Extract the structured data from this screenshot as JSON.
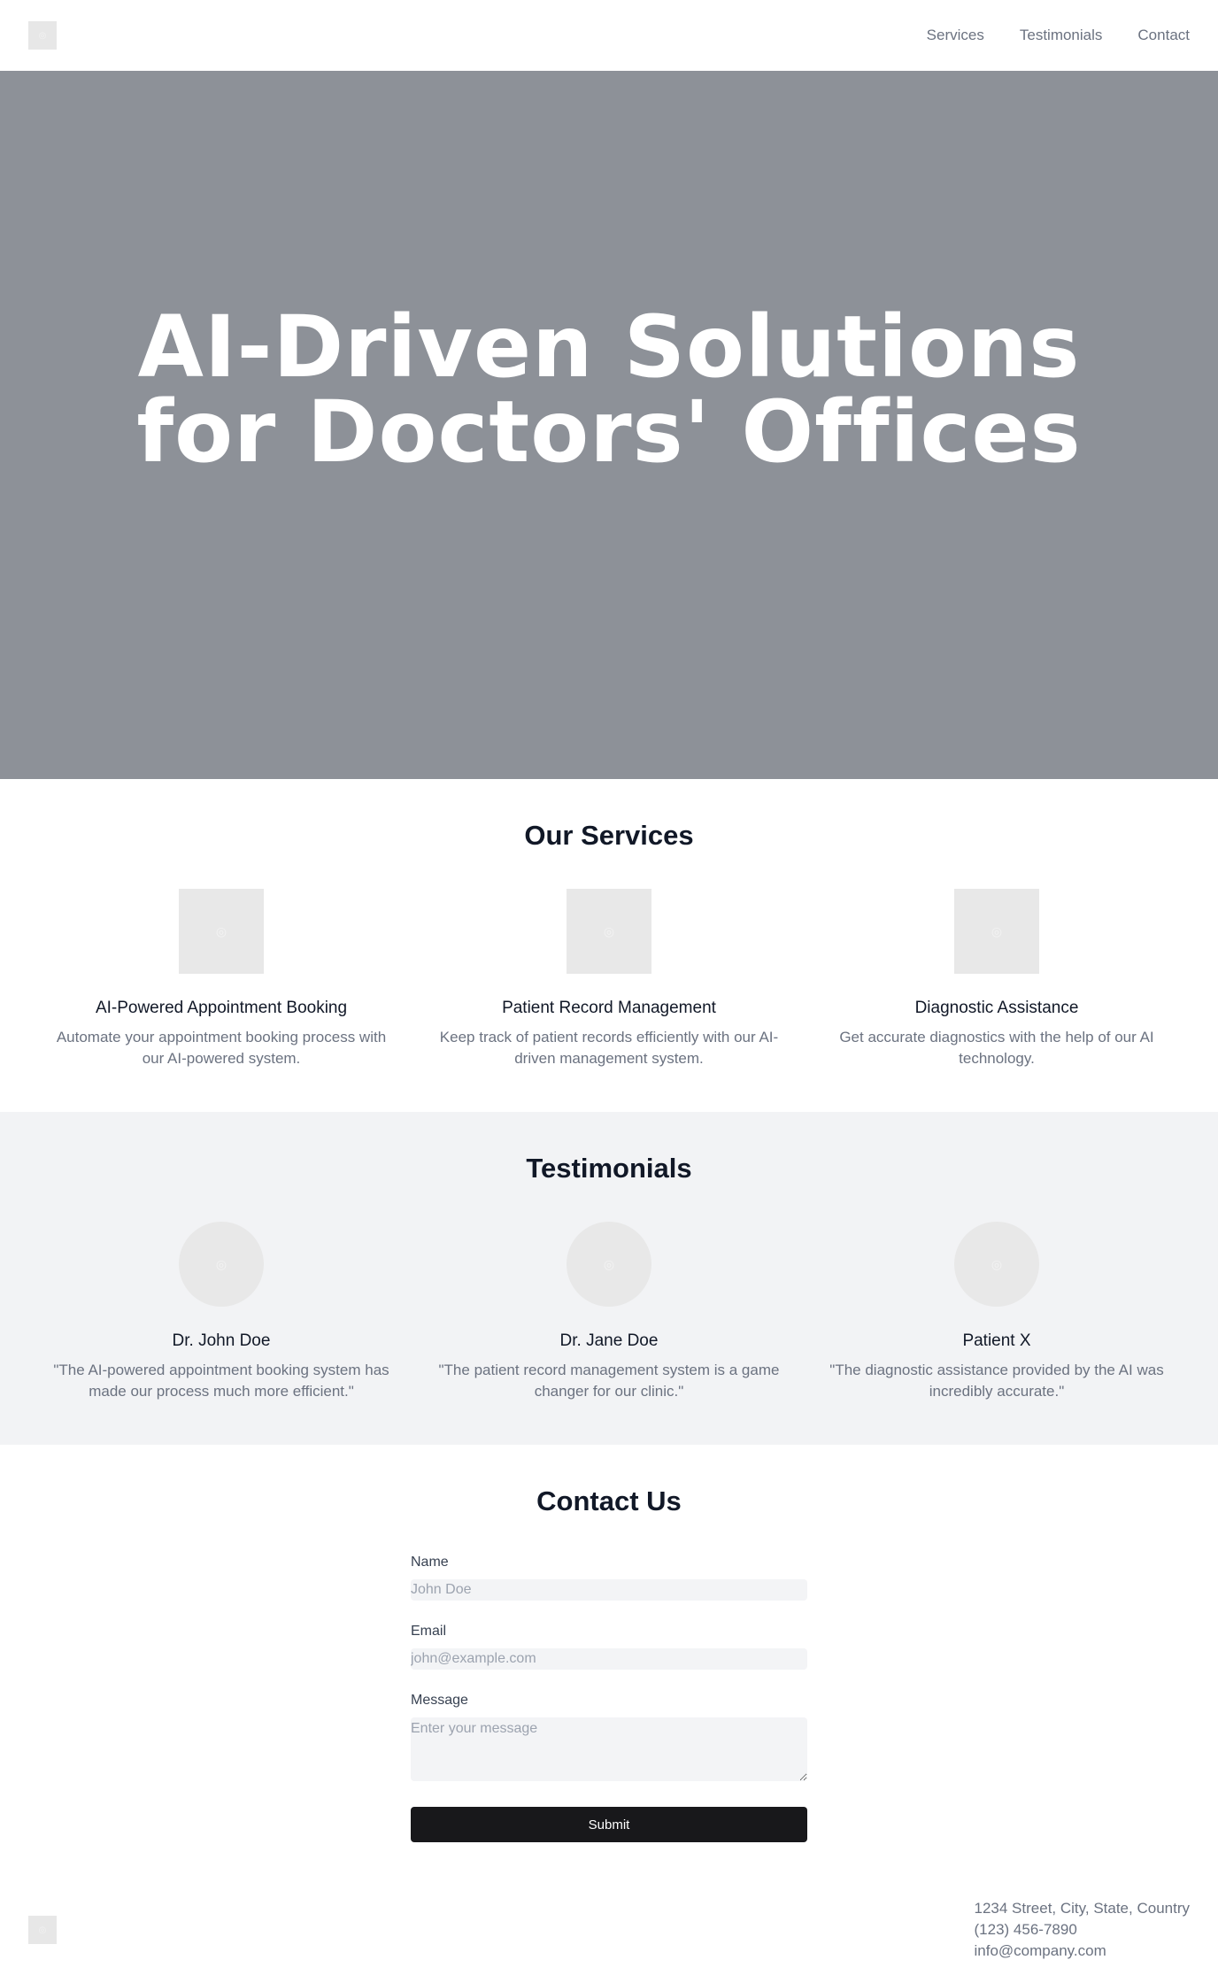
{
  "header": {
    "logo_glyph": "◎",
    "nav": [
      {
        "label": "Services"
      },
      {
        "label": "Testimonials"
      },
      {
        "label": "Contact"
      }
    ]
  },
  "hero": {
    "title": "AI-Driven Solutions for Doctors' Offices",
    "background_color": "#8d9198"
  },
  "services": {
    "title": "Our Services",
    "items": [
      {
        "title": "AI-Powered Appointment Booking",
        "description": "Automate your appointment booking process with our AI-powered system.",
        "icon": "image-placeholder-icon"
      },
      {
        "title": "Patient Record Management",
        "description": "Keep track of patient records efficiently with our AI-driven management system.",
        "icon": "image-placeholder-icon"
      },
      {
        "title": "Diagnostic Assistance",
        "description": "Get accurate diagnostics with the help of our AI technology.",
        "icon": "image-placeholder-icon"
      }
    ]
  },
  "testimonials": {
    "title": "Testimonials",
    "items": [
      {
        "name": "Dr. John Doe",
        "quote": "\"The AI-powered appointment booking system has made our process much more efficient.\"",
        "icon": "avatar-placeholder-icon"
      },
      {
        "name": "Dr. Jane Doe",
        "quote": "\"The patient record management system is a game changer for our clinic.\"",
        "icon": "avatar-placeholder-icon"
      },
      {
        "name": "Patient X",
        "quote": "\"The diagnostic assistance provided by the AI was incredibly accurate.\"",
        "icon": "avatar-placeholder-icon"
      }
    ]
  },
  "contact": {
    "title": "Contact Us",
    "name_label": "Name",
    "name_placeholder": "John Doe",
    "email_label": "Email",
    "email_placeholder": "john@example.com",
    "message_label": "Message",
    "message_placeholder": "Enter your message",
    "submit_label": "Submit"
  },
  "footer": {
    "address": "1234 Street, City, State, Country",
    "phone": "(123) 456-7890",
    "email": "info@company.com"
  },
  "colors": {
    "accent_button": "#18181b",
    "muted_text": "#6b7280",
    "section_alt_bg": "#f2f3f5"
  }
}
